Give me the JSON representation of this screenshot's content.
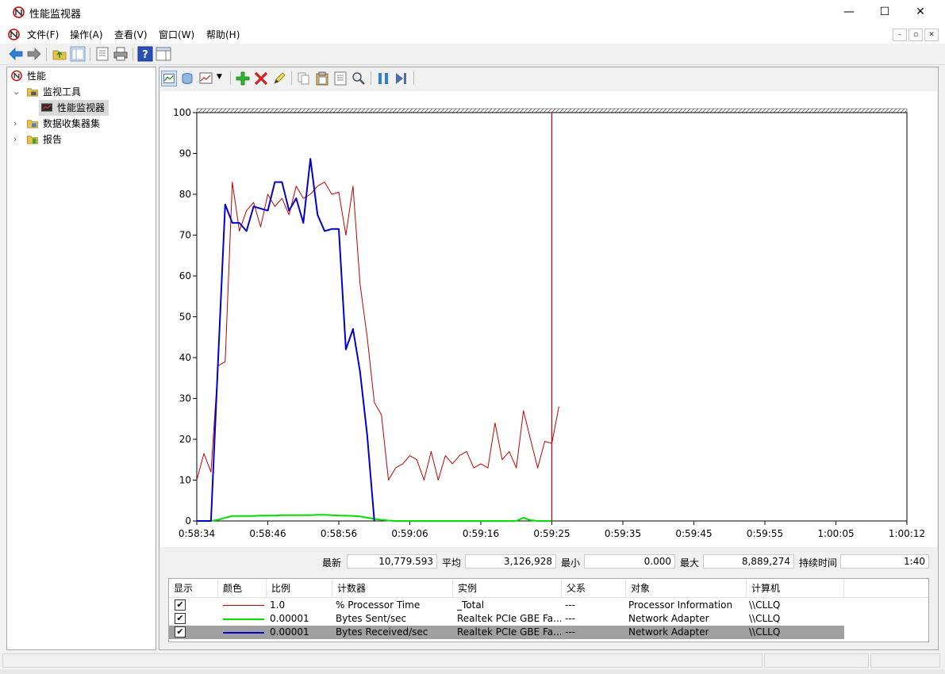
{
  "window": {
    "title": "性能监视器",
    "minimize": "—",
    "maximize": "☐",
    "close": "✕"
  },
  "menu": [
    "文件(F)",
    "操作(A)",
    "查看(V)",
    "窗口(W)",
    "帮助(H)"
  ],
  "mdi_controls": [
    "–",
    "▫",
    "✕"
  ],
  "tree": {
    "root": "性能",
    "monitoring_tools": "监视工具",
    "perf_monitor": "性能监视器",
    "data_collector_sets": "数据收集器集",
    "reports": "报告"
  },
  "stats": {
    "last_label": "最新",
    "last": "10,779.593",
    "avg_label": "平均",
    "avg": "3,126,928",
    "min_label": "最小",
    "min": "0.000",
    "max_label": "最大",
    "max": "8,889,274",
    "duration_label": "持续时间",
    "duration": "1:40"
  },
  "legend": {
    "headers": [
      "显示",
      "颜色",
      "比例",
      "计数器",
      "实例",
      "父系",
      "对象",
      "计算机"
    ],
    "rows": [
      {
        "checked": "✔",
        "color": "#c00000",
        "scale": "1.0",
        "counter": "% Processor Time",
        "instance": "_Total",
        "parent": "---",
        "object": "Processor Information",
        "computer": "\\\\CLLQ"
      },
      {
        "checked": "✔",
        "color": "#00e000",
        "scale": "0.00001",
        "counter": "Bytes Sent/sec",
        "instance": "Realtek PCIe GBE Fa...",
        "parent": "---",
        "object": "Network Adapter",
        "computer": "\\\\CLLQ"
      },
      {
        "checked": "✔",
        "color": "#0000cc",
        "scale": "0.00001",
        "counter": "Bytes Received/sec",
        "instance": "Realtek PCIe GBE Fa...",
        "parent": "---",
        "object": "Network Adapter",
        "computer": "\\\\CLLQ"
      }
    ]
  },
  "chart_data": {
    "type": "line",
    "ylim": [
      0,
      100
    ],
    "yticks": [
      0,
      10,
      20,
      30,
      40,
      50,
      60,
      70,
      80,
      90,
      100
    ],
    "xticks": [
      "0:58:34",
      "0:58:46",
      "0:58:56",
      "0:59:06",
      "0:59:16",
      "0:59:25",
      "0:59:35",
      "0:59:45",
      "0:59:55",
      "1:00:05",
      "1:00:12"
    ],
    "samples": 100,
    "cursor_index": 50,
    "series": [
      {
        "color": "#c00000",
        "width": 1,
        "values": [
          10,
          16.5,
          12,
          38,
          39,
          83,
          71,
          76,
          78,
          72,
          80,
          77,
          79,
          75,
          82,
          79,
          80,
          82,
          83,
          80,
          80.5,
          70,
          82,
          58,
          45,
          29,
          26,
          10,
          13,
          14,
          16,
          15,
          10,
          17,
          10,
          16,
          14,
          16,
          17,
          13,
          14,
          13,
          24,
          15,
          17,
          13,
          27,
          20,
          13,
          19.5,
          19,
          28
        ]
      },
      {
        "color": "#00e000",
        "width": 2,
        "values": [
          0,
          0,
          0,
          0.3,
          0.8,
          1.2,
          1.2,
          1.2,
          1.2,
          1.3,
          1.3,
          1.3,
          1.4,
          1.4,
          1.4,
          1.4,
          1.4,
          1.5,
          1.5,
          1.4,
          1.3,
          1.3,
          1.2,
          1.1,
          0.8,
          0.5,
          0.3,
          0.1,
          0,
          0,
          0,
          0,
          0,
          0,
          0,
          0,
          0,
          0,
          0,
          0,
          0,
          0,
          0,
          0,
          0,
          0,
          0.8,
          0.2,
          0,
          0,
          0
        ]
      },
      {
        "color": "#0000cc",
        "width": 2,
        "values": [
          0,
          0,
          0,
          39,
          77.5,
          73,
          73,
          71,
          77,
          76.5,
          76,
          83,
          83,
          76,
          79,
          73,
          88.7,
          75,
          71,
          71.5,
          71.5,
          42,
          47,
          36.5,
          21,
          0
        ]
      }
    ]
  }
}
